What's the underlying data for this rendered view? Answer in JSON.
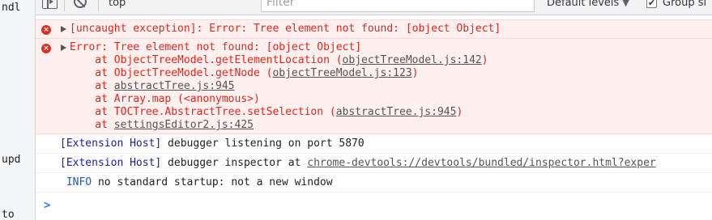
{
  "editor_strip": {
    "lines": [
      "ndl",
      "upd",
      "to"
    ]
  },
  "toolbar": {
    "context": "top",
    "filter_placeholder": "Filter",
    "levels_label": "Default levels",
    "levels_caret": "▼",
    "group_check": "✔",
    "group_label": "Group si"
  },
  "messages": {
    "error1": {
      "icon": "×",
      "text": "[uncaught exception]: Error: Tree element not found: [object Object]"
    },
    "error2": {
      "icon": "×",
      "header": "Error: Tree element not found: [object Object]",
      "stack": [
        {
          "prefix": "    at ObjectTreeModel.getElementLocation (",
          "link": "objectTreeModel.js:142",
          "suffix": ")"
        },
        {
          "prefix": "    at ObjectTreeModel.getNode (",
          "link": "objectTreeModel.js:123",
          "suffix": ")"
        },
        {
          "prefix": "    at ",
          "link": "abstractTree.js:945",
          "suffix": ""
        },
        {
          "prefix": "    at Array.map (<anonymous>)",
          "link": "",
          "suffix": ""
        },
        {
          "prefix": "    at TOCTree.AbstractTree.setSelection (",
          "link": "abstractTree.js:945",
          "suffix": ")"
        },
        {
          "prefix": "    at ",
          "link": "settingsEditor2.js:425",
          "suffix": ""
        }
      ]
    },
    "log1": {
      "tag": "[Extension Host]",
      "text": " debugger listening on port 5870"
    },
    "log2": {
      "tag": "[Extension Host]",
      "text": " debugger inspector at ",
      "link": "chrome-devtools://devtools/bundled/inspector.html?exper"
    },
    "log3": {
      "level": " INFO",
      "text": " no standard startup: not a new window"
    }
  },
  "prompt": ">"
}
